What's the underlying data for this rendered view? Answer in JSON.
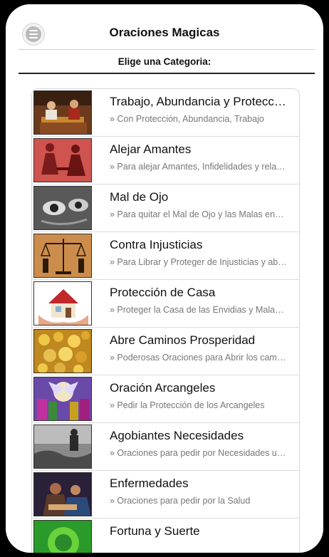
{
  "header": {
    "title": "Oraciones Magicas",
    "menu_icon": "hamburger-icon"
  },
  "subtitle": "Elige una Categoria:",
  "categories": [
    {
      "title": "Trabajo, Abundancia y Protección",
      "desc": "» Con Protección, Abundancia, Trabajo"
    },
    {
      "title": "Alejar Amantes",
      "desc": "» Para alejar Amantes, Infidelidades y relaciones"
    },
    {
      "title": "Mal de Ojo",
      "desc": "» Para quitar el Mal de Ojo y las Malas energías"
    },
    {
      "title": "Contra Injusticias",
      "desc": "» Para Librar y Proteger de Injusticias y abusos"
    },
    {
      "title": "Protección de Casa",
      "desc": "» Proteger la Casa de las Envidias y Malas energías"
    },
    {
      "title": "Abre Caminos Prosperidad",
      "desc": "» Poderosas Oraciones para Abrir los caminos"
    },
    {
      "title": "Oración Arcangeles",
      "desc": "» Pedir la Protección de los Arcangeles"
    },
    {
      "title": "Agobiantes Necesidades",
      "desc": "» Oraciones para pedir por Necesidades urgentes"
    },
    {
      "title": "Enfermedades",
      "desc": "» Oraciones para pedir por la Salud"
    },
    {
      "title": "Fortuna y Suerte",
      "desc": ""
    }
  ]
}
